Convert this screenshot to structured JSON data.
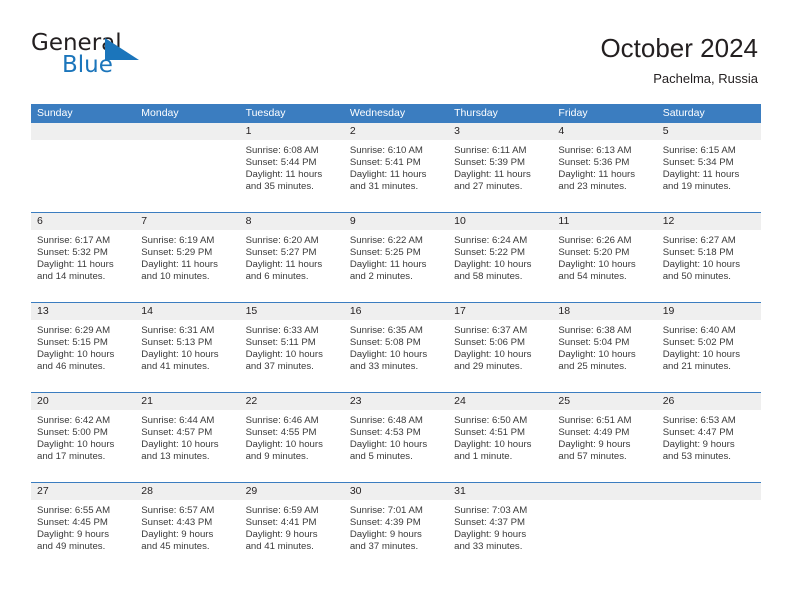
{
  "brand": {
    "name_part1": "General",
    "name_part2": "Blue",
    "triangle_icon": "triangle-icon",
    "colors": {
      "blue": "#1b75bb",
      "dark": "#231f20"
    }
  },
  "header": {
    "title": "October 2024",
    "location": "Pachelma, Russia"
  },
  "theme": {
    "header_blue": "#3b7dc0",
    "date_band": "#efefef",
    "text": "#3a3a3a"
  },
  "calendar": {
    "weekdays": [
      "Sunday",
      "Monday",
      "Tuesday",
      "Wednesday",
      "Thursday",
      "Friday",
      "Saturday"
    ],
    "weeks": [
      [
        {
          "day": "",
          "lines": []
        },
        {
          "day": "",
          "lines": []
        },
        {
          "day": "1",
          "lines": [
            "Sunrise: 6:08 AM",
            "Sunset: 5:44 PM",
            "Daylight: 11 hours",
            "and 35 minutes."
          ]
        },
        {
          "day": "2",
          "lines": [
            "Sunrise: 6:10 AM",
            "Sunset: 5:41 PM",
            "Daylight: 11 hours",
            "and 31 minutes."
          ]
        },
        {
          "day": "3",
          "lines": [
            "Sunrise: 6:11 AM",
            "Sunset: 5:39 PM",
            "Daylight: 11 hours",
            "and 27 minutes."
          ]
        },
        {
          "day": "4",
          "lines": [
            "Sunrise: 6:13 AM",
            "Sunset: 5:36 PM",
            "Daylight: 11 hours",
            "and 23 minutes."
          ]
        },
        {
          "day": "5",
          "lines": [
            "Sunrise: 6:15 AM",
            "Sunset: 5:34 PM",
            "Daylight: 11 hours",
            "and 19 minutes."
          ]
        }
      ],
      [
        {
          "day": "6",
          "lines": [
            "Sunrise: 6:17 AM",
            "Sunset: 5:32 PM",
            "Daylight: 11 hours",
            "and 14 minutes."
          ]
        },
        {
          "day": "7",
          "lines": [
            "Sunrise: 6:19 AM",
            "Sunset: 5:29 PM",
            "Daylight: 11 hours",
            "and 10 minutes."
          ]
        },
        {
          "day": "8",
          "lines": [
            "Sunrise: 6:20 AM",
            "Sunset: 5:27 PM",
            "Daylight: 11 hours",
            "and 6 minutes."
          ]
        },
        {
          "day": "9",
          "lines": [
            "Sunrise: 6:22 AM",
            "Sunset: 5:25 PM",
            "Daylight: 11 hours",
            "and 2 minutes."
          ]
        },
        {
          "day": "10",
          "lines": [
            "Sunrise: 6:24 AM",
            "Sunset: 5:22 PM",
            "Daylight: 10 hours",
            "and 58 minutes."
          ]
        },
        {
          "day": "11",
          "lines": [
            "Sunrise: 6:26 AM",
            "Sunset: 5:20 PM",
            "Daylight: 10 hours",
            "and 54 minutes."
          ]
        },
        {
          "day": "12",
          "lines": [
            "Sunrise: 6:27 AM",
            "Sunset: 5:18 PM",
            "Daylight: 10 hours",
            "and 50 minutes."
          ]
        }
      ],
      [
        {
          "day": "13",
          "lines": [
            "Sunrise: 6:29 AM",
            "Sunset: 5:15 PM",
            "Daylight: 10 hours",
            "and 46 minutes."
          ]
        },
        {
          "day": "14",
          "lines": [
            "Sunrise: 6:31 AM",
            "Sunset: 5:13 PM",
            "Daylight: 10 hours",
            "and 41 minutes."
          ]
        },
        {
          "day": "15",
          "lines": [
            "Sunrise: 6:33 AM",
            "Sunset: 5:11 PM",
            "Daylight: 10 hours",
            "and 37 minutes."
          ]
        },
        {
          "day": "16",
          "lines": [
            "Sunrise: 6:35 AM",
            "Sunset: 5:08 PM",
            "Daylight: 10 hours",
            "and 33 minutes."
          ]
        },
        {
          "day": "17",
          "lines": [
            "Sunrise: 6:37 AM",
            "Sunset: 5:06 PM",
            "Daylight: 10 hours",
            "and 29 minutes."
          ]
        },
        {
          "day": "18",
          "lines": [
            "Sunrise: 6:38 AM",
            "Sunset: 5:04 PM",
            "Daylight: 10 hours",
            "and 25 minutes."
          ]
        },
        {
          "day": "19",
          "lines": [
            "Sunrise: 6:40 AM",
            "Sunset: 5:02 PM",
            "Daylight: 10 hours",
            "and 21 minutes."
          ]
        }
      ],
      [
        {
          "day": "20",
          "lines": [
            "Sunrise: 6:42 AM",
            "Sunset: 5:00 PM",
            "Daylight: 10 hours",
            "and 17 minutes."
          ]
        },
        {
          "day": "21",
          "lines": [
            "Sunrise: 6:44 AM",
            "Sunset: 4:57 PM",
            "Daylight: 10 hours",
            "and 13 minutes."
          ]
        },
        {
          "day": "22",
          "lines": [
            "Sunrise: 6:46 AM",
            "Sunset: 4:55 PM",
            "Daylight: 10 hours",
            "and 9 minutes."
          ]
        },
        {
          "day": "23",
          "lines": [
            "Sunrise: 6:48 AM",
            "Sunset: 4:53 PM",
            "Daylight: 10 hours",
            "and 5 minutes."
          ]
        },
        {
          "day": "24",
          "lines": [
            "Sunrise: 6:50 AM",
            "Sunset: 4:51 PM",
            "Daylight: 10 hours",
            "and 1 minute."
          ]
        },
        {
          "day": "25",
          "lines": [
            "Sunrise: 6:51 AM",
            "Sunset: 4:49 PM",
            "Daylight: 9 hours",
            "and 57 minutes."
          ]
        },
        {
          "day": "26",
          "lines": [
            "Sunrise: 6:53 AM",
            "Sunset: 4:47 PM",
            "Daylight: 9 hours",
            "and 53 minutes."
          ]
        }
      ],
      [
        {
          "day": "27",
          "lines": [
            "Sunrise: 6:55 AM",
            "Sunset: 4:45 PM",
            "Daylight: 9 hours",
            "and 49 minutes."
          ]
        },
        {
          "day": "28",
          "lines": [
            "Sunrise: 6:57 AM",
            "Sunset: 4:43 PM",
            "Daylight: 9 hours",
            "and 45 minutes."
          ]
        },
        {
          "day": "29",
          "lines": [
            "Sunrise: 6:59 AM",
            "Sunset: 4:41 PM",
            "Daylight: 9 hours",
            "and 41 minutes."
          ]
        },
        {
          "day": "30",
          "lines": [
            "Sunrise: 7:01 AM",
            "Sunset: 4:39 PM",
            "Daylight: 9 hours",
            "and 37 minutes."
          ]
        },
        {
          "day": "31",
          "lines": [
            "Sunrise: 7:03 AM",
            "Sunset: 4:37 PM",
            "Daylight: 9 hours",
            "and 33 minutes."
          ]
        },
        {
          "day": "",
          "lines": []
        },
        {
          "day": "",
          "lines": []
        }
      ]
    ]
  }
}
